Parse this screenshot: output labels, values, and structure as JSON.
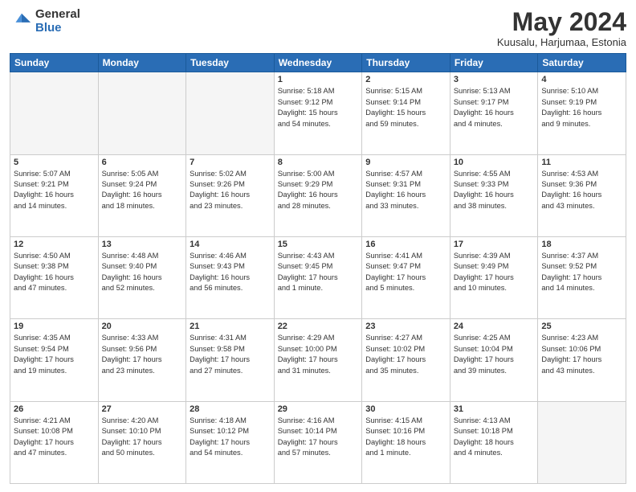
{
  "header": {
    "logo_general": "General",
    "logo_blue": "Blue",
    "month": "May 2024",
    "location": "Kuusalu, Harjumaa, Estonia"
  },
  "days_of_week": [
    "Sunday",
    "Monday",
    "Tuesday",
    "Wednesday",
    "Thursday",
    "Friday",
    "Saturday"
  ],
  "weeks": [
    [
      {
        "num": "",
        "info": ""
      },
      {
        "num": "",
        "info": ""
      },
      {
        "num": "",
        "info": ""
      },
      {
        "num": "1",
        "info": "Sunrise: 5:18 AM\nSunset: 9:12 PM\nDaylight: 15 hours\nand 54 minutes."
      },
      {
        "num": "2",
        "info": "Sunrise: 5:15 AM\nSunset: 9:14 PM\nDaylight: 15 hours\nand 59 minutes."
      },
      {
        "num": "3",
        "info": "Sunrise: 5:13 AM\nSunset: 9:17 PM\nDaylight: 16 hours\nand 4 minutes."
      },
      {
        "num": "4",
        "info": "Sunrise: 5:10 AM\nSunset: 9:19 PM\nDaylight: 16 hours\nand 9 minutes."
      }
    ],
    [
      {
        "num": "5",
        "info": "Sunrise: 5:07 AM\nSunset: 9:21 PM\nDaylight: 16 hours\nand 14 minutes."
      },
      {
        "num": "6",
        "info": "Sunrise: 5:05 AM\nSunset: 9:24 PM\nDaylight: 16 hours\nand 18 minutes."
      },
      {
        "num": "7",
        "info": "Sunrise: 5:02 AM\nSunset: 9:26 PM\nDaylight: 16 hours\nand 23 minutes."
      },
      {
        "num": "8",
        "info": "Sunrise: 5:00 AM\nSunset: 9:29 PM\nDaylight: 16 hours\nand 28 minutes."
      },
      {
        "num": "9",
        "info": "Sunrise: 4:57 AM\nSunset: 9:31 PM\nDaylight: 16 hours\nand 33 minutes."
      },
      {
        "num": "10",
        "info": "Sunrise: 4:55 AM\nSunset: 9:33 PM\nDaylight: 16 hours\nand 38 minutes."
      },
      {
        "num": "11",
        "info": "Sunrise: 4:53 AM\nSunset: 9:36 PM\nDaylight: 16 hours\nand 43 minutes."
      }
    ],
    [
      {
        "num": "12",
        "info": "Sunrise: 4:50 AM\nSunset: 9:38 PM\nDaylight: 16 hours\nand 47 minutes."
      },
      {
        "num": "13",
        "info": "Sunrise: 4:48 AM\nSunset: 9:40 PM\nDaylight: 16 hours\nand 52 minutes."
      },
      {
        "num": "14",
        "info": "Sunrise: 4:46 AM\nSunset: 9:43 PM\nDaylight: 16 hours\nand 56 minutes."
      },
      {
        "num": "15",
        "info": "Sunrise: 4:43 AM\nSunset: 9:45 PM\nDaylight: 17 hours\nand 1 minute."
      },
      {
        "num": "16",
        "info": "Sunrise: 4:41 AM\nSunset: 9:47 PM\nDaylight: 17 hours\nand 5 minutes."
      },
      {
        "num": "17",
        "info": "Sunrise: 4:39 AM\nSunset: 9:49 PM\nDaylight: 17 hours\nand 10 minutes."
      },
      {
        "num": "18",
        "info": "Sunrise: 4:37 AM\nSunset: 9:52 PM\nDaylight: 17 hours\nand 14 minutes."
      }
    ],
    [
      {
        "num": "19",
        "info": "Sunrise: 4:35 AM\nSunset: 9:54 PM\nDaylight: 17 hours\nand 19 minutes."
      },
      {
        "num": "20",
        "info": "Sunrise: 4:33 AM\nSunset: 9:56 PM\nDaylight: 17 hours\nand 23 minutes."
      },
      {
        "num": "21",
        "info": "Sunrise: 4:31 AM\nSunset: 9:58 PM\nDaylight: 17 hours\nand 27 minutes."
      },
      {
        "num": "22",
        "info": "Sunrise: 4:29 AM\nSunset: 10:00 PM\nDaylight: 17 hours\nand 31 minutes."
      },
      {
        "num": "23",
        "info": "Sunrise: 4:27 AM\nSunset: 10:02 PM\nDaylight: 17 hours\nand 35 minutes."
      },
      {
        "num": "24",
        "info": "Sunrise: 4:25 AM\nSunset: 10:04 PM\nDaylight: 17 hours\nand 39 minutes."
      },
      {
        "num": "25",
        "info": "Sunrise: 4:23 AM\nSunset: 10:06 PM\nDaylight: 17 hours\nand 43 minutes."
      }
    ],
    [
      {
        "num": "26",
        "info": "Sunrise: 4:21 AM\nSunset: 10:08 PM\nDaylight: 17 hours\nand 47 minutes."
      },
      {
        "num": "27",
        "info": "Sunrise: 4:20 AM\nSunset: 10:10 PM\nDaylight: 17 hours\nand 50 minutes."
      },
      {
        "num": "28",
        "info": "Sunrise: 4:18 AM\nSunset: 10:12 PM\nDaylight: 17 hours\nand 54 minutes."
      },
      {
        "num": "29",
        "info": "Sunrise: 4:16 AM\nSunset: 10:14 PM\nDaylight: 17 hours\nand 57 minutes."
      },
      {
        "num": "30",
        "info": "Sunrise: 4:15 AM\nSunset: 10:16 PM\nDaylight: 18 hours\nand 1 minute."
      },
      {
        "num": "31",
        "info": "Sunrise: 4:13 AM\nSunset: 10:18 PM\nDaylight: 18 hours\nand 4 minutes."
      },
      {
        "num": "",
        "info": ""
      }
    ]
  ]
}
